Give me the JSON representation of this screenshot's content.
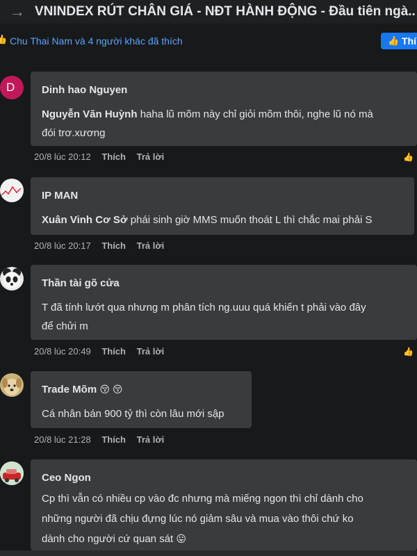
{
  "header": {
    "title": "VNINDEX RÚT CHÂN GIÁ - NĐT HÀNH ĐỘNG - Đầu tiên ngà..."
  },
  "likes": {
    "text": "Chu Thai Nam và 4 người khác đã thích",
    "like_button_label": "Thí"
  },
  "actions": {
    "like": "Thích",
    "reply": "Trả lời"
  },
  "comments": [
    {
      "author": "Dinh hao Nguyen",
      "avatar_letter": "D",
      "mention": "Nguyễn Văn Huỳnh",
      "text": "haha lũ mõm này chỉ giỏi mõm thôi, nghe lũ nó mà",
      "text2": "đói trơ.xương",
      "time": "20/8 lúc 20:12"
    },
    {
      "author": "IP MAN",
      "mention": "Xuân Vinh Cơ Sở",
      "text": "phái sinh giờ MMS muốn thoát L thì chắc mai phải S",
      "time": "20/8 lúc 20:17"
    },
    {
      "author": "Thần tài gõ cửa",
      "text": "T đã tính lướt qua nhưng m phân tích ng.uuu quá khiến t phải vào đây",
      "text2": "để chửi m",
      "time": "20/8 lúc 20:49"
    },
    {
      "author": "Trade Mõm",
      "author_emoji": "😚 😚",
      "text": "Cá nhân bán 900 tỷ thì còn lâu mới sập",
      "time": "20/8 lúc 21:28"
    },
    {
      "author": "Ceo Ngon",
      "text": "Cp thì vẫn có nhiều cp vào đc nhưng mà miếng ngon thì chỉ dành cho",
      "text2": "những người đã chịu đựng lúc nó giảm sâu và mua vào thôi chứ ko",
      "text3": "dành cho người cứ quan sát",
      "text3_emoji": "😛"
    }
  ],
  "colors": {
    "background": "#18191a",
    "bubble": "#3a3b3c",
    "accent": "#1877f2",
    "link": "#5aa4ff"
  },
  "icons": [
    "back-arrow-icon",
    "thumbs-up-icon"
  ]
}
